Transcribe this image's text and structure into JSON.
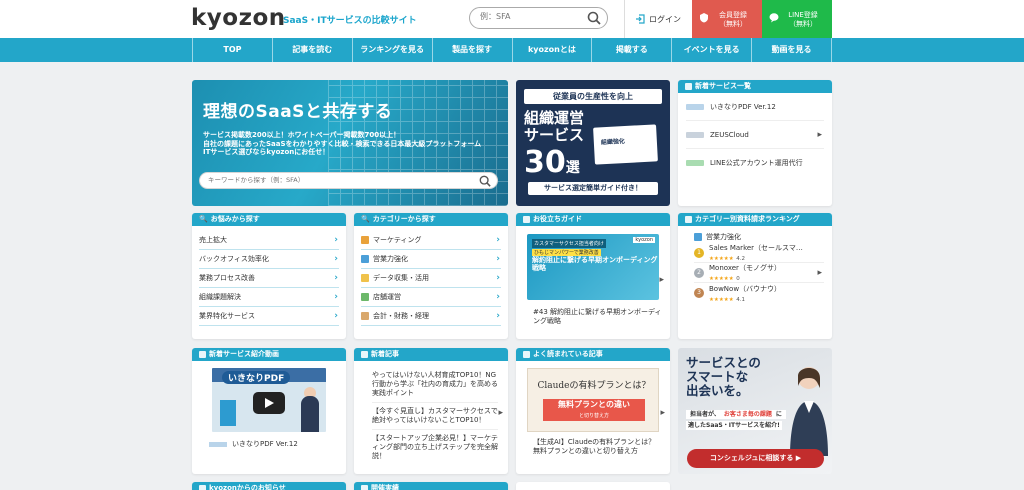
{
  "header": {
    "logo": "kyozon",
    "tagline": "SaaS・ITサービスの比較サイト",
    "search_placeholder": "例：SFA",
    "login": "ログイン",
    "register": [
      "会員登録",
      "（無料）"
    ],
    "line": [
      "LINE登録",
      "（無料）"
    ]
  },
  "nav": [
    "TOP",
    "記事を読む",
    "ランキングを見る",
    "製品を探す",
    "kyozonとは",
    "掲載する",
    "イベントを見る",
    "動画を見る"
  ],
  "hero": {
    "title": "理想のSaaSと共存する",
    "lines": [
      "サービス掲載数200以上！ホワイトペーパー掲載数700以上！",
      "自社の課題にあったSaaSをわかりやすく比較・検索できる日本最大級プラットフォーム",
      "ITサービス選びならkyozonにお任せ！"
    ],
    "search_placeholder": "キーワードから探す（例：SFA）"
  },
  "banner": {
    "top": "従業員の生産性を向上",
    "big1": "組織運営",
    "big2": "サービス",
    "num": "30",
    "num_suffix": "選",
    "book": "組織強化",
    "btn": "サービス選定簡単ガイド付き！"
  },
  "new_services": {
    "title": "新着サービス一覧",
    "items": [
      "いきなりPDF Ver.12",
      "ZEUSCloud",
      "LINE公式アカウント運用代行"
    ]
  },
  "problems": {
    "title": "お悩みから探す",
    "items": [
      "売上拡大",
      "バックオフィス効率化",
      "業務プロセス改善",
      "組織課題解決",
      "業界特化サービス"
    ]
  },
  "categories": {
    "title": "カテゴリーから探す",
    "items": [
      "マーケティング",
      "営業力強化",
      "データ収集・活用",
      "店舗運営",
      "会計・財務・経理"
    ]
  },
  "guide": {
    "title": "お役立ちガイド",
    "img_tag": "カスタマーサクセス担当者向け",
    "img_hl": "ひもじマンパワーで業務改善",
    "img_title": "解約阻止に繋げる早期オンボーディング戦略",
    "img_brand": "kyozon",
    "text": "#43 解約阻止に繋げる早期オンボーディング戦略"
  },
  "ranking": {
    "title": "カテゴリー別資料請求ランキング",
    "category": "営業力強化",
    "items": [
      {
        "rank": "1",
        "name": "Sales Marker（セールスマ…",
        "stars": "★★★★★",
        "score": "4.2"
      },
      {
        "rank": "2",
        "name": "Monoxer（モノグサ）",
        "stars": "★★★★★",
        "score": "0"
      },
      {
        "rank": "3",
        "name": "BowNow（バウナウ）",
        "stars": "★★★★★",
        "score": "4.1"
      }
    ]
  },
  "video": {
    "title": "新着サービス紹介動画",
    "thumb_title": "いきなりPDF",
    "caption": "いきなりPDF Ver.12"
  },
  "articles": {
    "title": "新着記事",
    "items": [
      "やってはいけない人材育成TOP10！NG行動から学ぶ「社内の育成力」を高める実践ポイント",
      "【今すぐ見直し】カスタマーサクセスで絶対やってはいけないことTOP10！",
      "【スタートアップ企業必見！】マーケティング部門の立ち上げステップを完全解説！"
    ]
  },
  "popular": {
    "title": "よく読まれている記事",
    "img_title": "Claudeの有料プランとは？",
    "img_red": "無料プランとの違い",
    "img_red_sub": "と切り替え方",
    "text": "【生成AI】Claudeの有料プランとは？無料プランとの違いと切り替え方"
  },
  "concierge": {
    "heading": [
      "サービスとの",
      "スマートな",
      "出会いを。"
    ],
    "line1_a": "担当者が、",
    "line1_b": "お客さま毎の課題",
    "line1_c": "に",
    "line2": "適したSaaS・ITサービスを紹介!",
    "button": "コンシェルジュに相談する ▶"
  },
  "bottom": [
    "kyozonからのお知らせ",
    "開催実績"
  ]
}
